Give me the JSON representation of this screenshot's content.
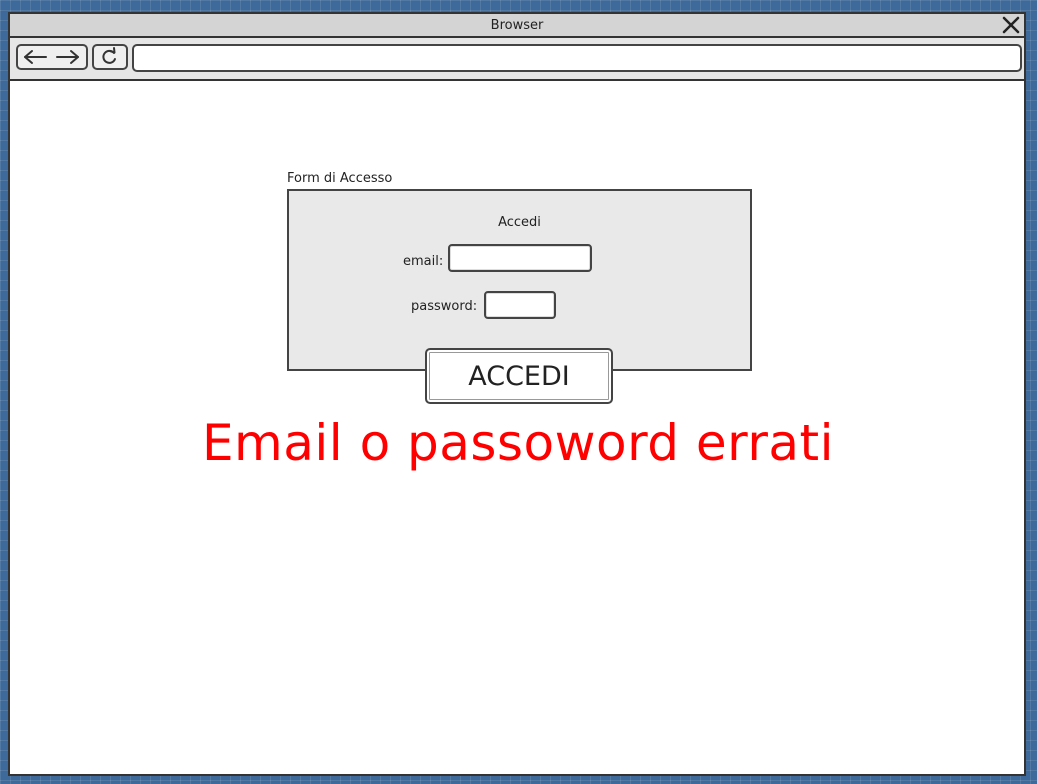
{
  "window": {
    "title": "Browser"
  },
  "toolbar": {
    "back_icon": "arrow-left-icon",
    "forward_icon": "arrow-right-icon",
    "reload_icon": "reload-icon",
    "close_icon": "close-icon",
    "address_value": ""
  },
  "form": {
    "legend": "Form di Accesso",
    "heading": "Accedi",
    "email_label": "email:",
    "email_value": "",
    "password_label": "password:",
    "password_value": "",
    "submit_label": "ACCEDI"
  },
  "error": {
    "message": "Email o passoword errati",
    "color": "#ff0000"
  },
  "colors": {
    "desktop": "#3d6a9a",
    "panel": "#e9e9e9"
  }
}
